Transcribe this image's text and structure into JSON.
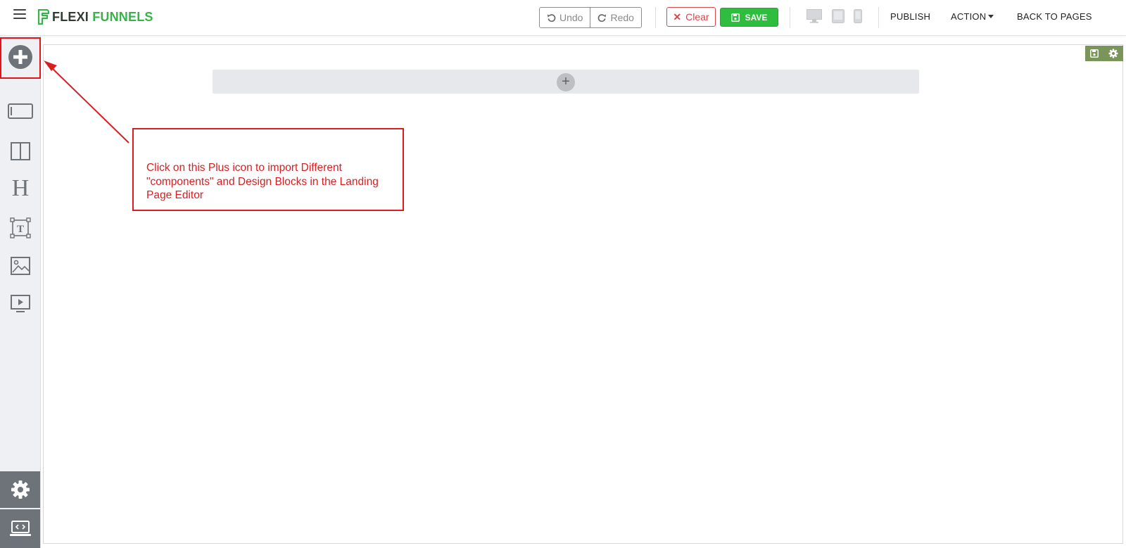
{
  "header": {
    "logo": {
      "word1": "FLEXI",
      "word2": "FUNNELS"
    },
    "undo_label": "Undo",
    "redo_label": "Redo",
    "clear_label": "Clear",
    "save_label": "SAVE",
    "devices": [
      "desktop-icon",
      "tablet-icon",
      "mobile-icon"
    ],
    "nav": {
      "publish": "PUBLISH",
      "action": "ACTION",
      "back": "BACK TO PAGES"
    }
  },
  "sidebar": {
    "items": [
      "add-icon",
      "section-icon",
      "columns-icon",
      "heading-icon",
      "text-icon",
      "image-icon",
      "video-icon"
    ],
    "bottom": [
      "settings-icon",
      "code-icon"
    ]
  },
  "canvas": {
    "add_section_symbol": "+",
    "corner_tools": [
      "save-icon",
      "gear-icon"
    ]
  },
  "annotation": {
    "text": "Click on this Plus icon to import Different \"components\" and Design Blocks  in the Landing Page Editor"
  },
  "colors": {
    "brand_green": "#37b34a",
    "save_green": "#2ebd3f",
    "clear_red": "#d8464b",
    "annotation_red": "#d91e22",
    "sidebar_bg": "#eef0f4",
    "sidebar_bottom": "#6e7379",
    "corner_tools_bg": "#79955a"
  }
}
